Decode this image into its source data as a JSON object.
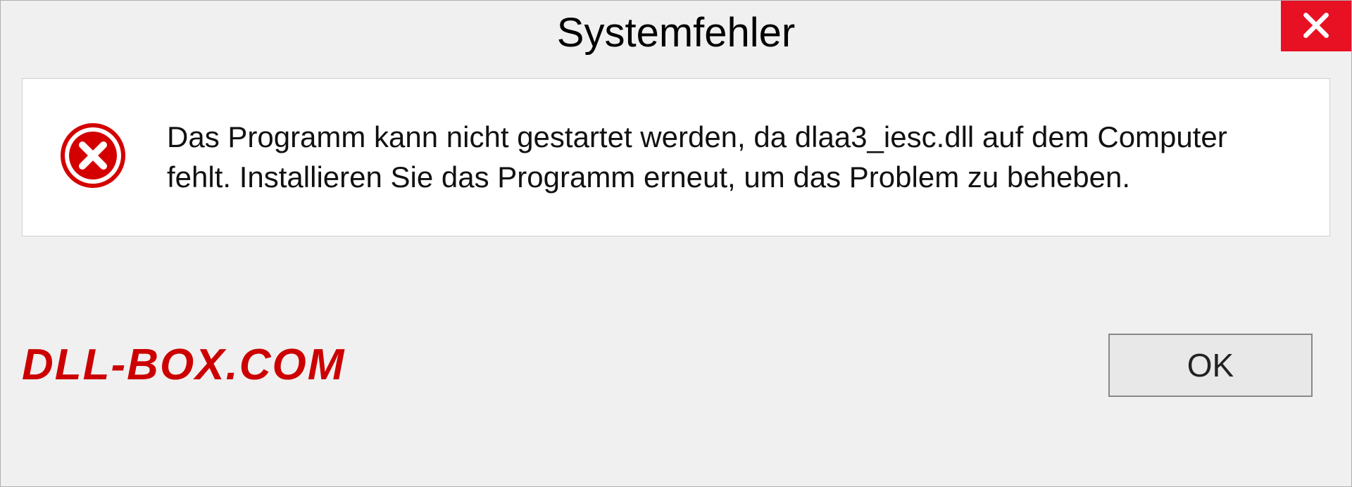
{
  "title": "Systemfehler",
  "message": "Das Programm kann nicht gestartet werden, da dlaa3_iesc.dll auf dem Computer fehlt. Installieren Sie das Programm erneut, um das Problem zu beheben.",
  "watermark": "DLL-BOX.COM",
  "buttons": {
    "ok": "OK"
  }
}
